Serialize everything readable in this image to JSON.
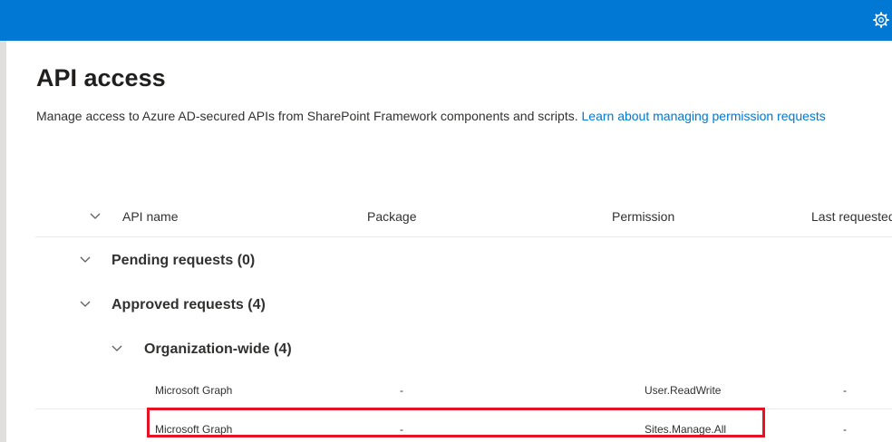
{
  "page": {
    "title": "API access",
    "description": "Manage access to Azure AD-secured APIs from SharePoint Framework components and scripts.",
    "learn_link": "Learn about managing permission requests"
  },
  "table": {
    "columns": [
      "API name",
      "Package",
      "Permission",
      "Last requested"
    ],
    "groups": {
      "pending": "Pending requests (0)",
      "approved": "Approved requests (4)",
      "org_wide": "Organization-wide (4)"
    },
    "rows": [
      {
        "api": "Microsoft Graph",
        "package": "-",
        "permission": "User.ReadWrite",
        "last": "-"
      },
      {
        "api": "Microsoft Graph",
        "package": "-",
        "permission": "Sites.Manage.All",
        "last": "-"
      }
    ]
  },
  "colors": {
    "accent": "#0078d4",
    "highlight": "#e81123"
  },
  "icons": {
    "settings": "gear-icon",
    "expand": "chevron-down-icon"
  }
}
